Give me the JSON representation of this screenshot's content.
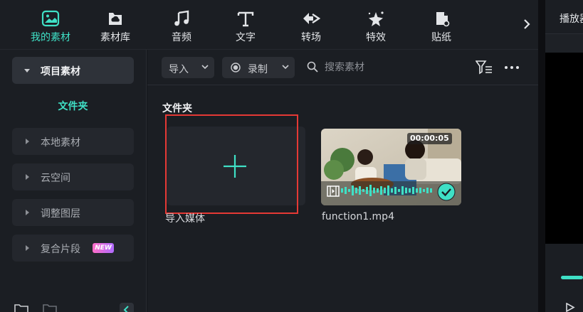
{
  "toolbar": {
    "tabs": [
      {
        "label": "我的素材",
        "icon": "media-folder-icon",
        "active": true
      },
      {
        "label": "素材库",
        "icon": "cloud-library-icon"
      },
      {
        "label": "音频",
        "icon": "music-note-icon"
      },
      {
        "label": "文字",
        "icon": "text-t-icon"
      },
      {
        "label": "转场",
        "icon": "transition-icon"
      },
      {
        "label": "特效",
        "icon": "sparkle-effect-icon"
      },
      {
        "label": "贴纸",
        "icon": "sticker-icon"
      }
    ],
    "more": "chevron-right-icon"
  },
  "preview": {
    "title": "播放器"
  },
  "sidebar": {
    "project_media": "项目素材",
    "folder": "文件夹",
    "items": [
      {
        "label": "本地素材"
      },
      {
        "label": "云空间"
      },
      {
        "label": "调整图层"
      },
      {
        "label": "复合片段",
        "badge": "NEW"
      }
    ]
  },
  "main": {
    "import_label": "导入",
    "record_label": "录制",
    "search_placeholder": "搜索素材",
    "section_title": "文件夹",
    "tiles": [
      {
        "label": "导入媒体",
        "kind": "import"
      },
      {
        "label": "function1.mp4",
        "duration": "00:00:05",
        "kind": "video"
      }
    ]
  },
  "colors": {
    "accent": "#3fe0c6",
    "highlight": "#e53935",
    "panel": "#1b1e23"
  }
}
